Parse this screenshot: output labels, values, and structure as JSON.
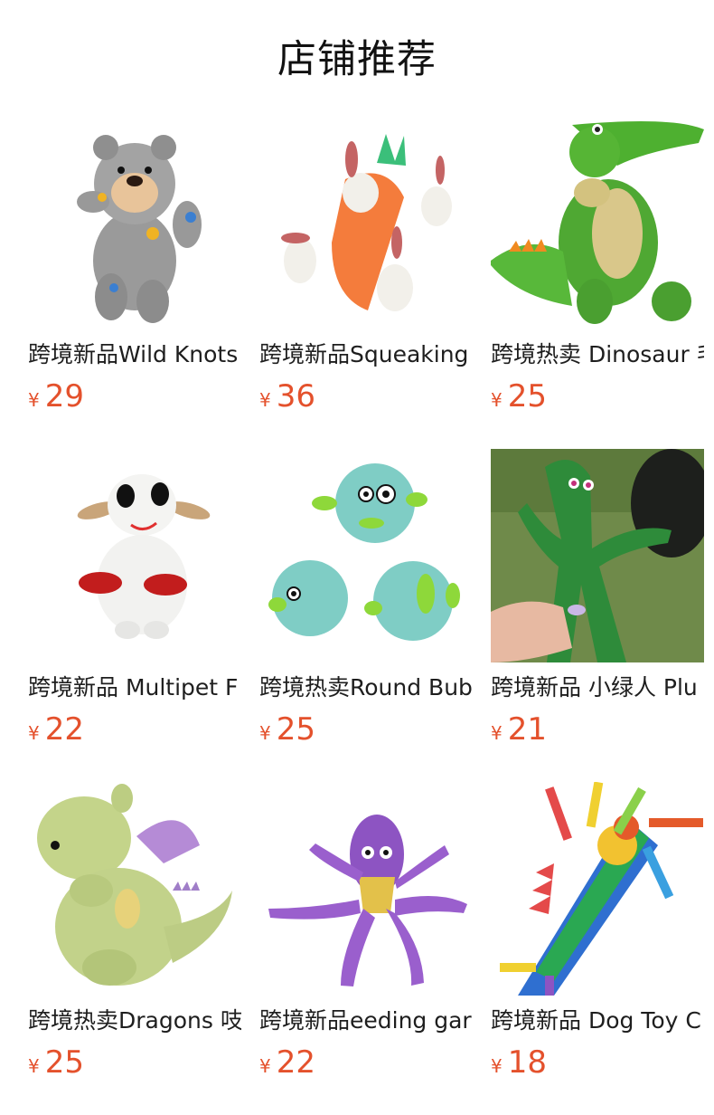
{
  "section_title": "店铺推荐",
  "currency_symbol": "¥",
  "price_color": "#e4512c",
  "products": [
    {
      "name": "跨境新品Wild Knots",
      "price": "29",
      "image": "grey-bear-plush"
    },
    {
      "name": "跨境新品Squeaking",
      "price": "36",
      "image": "carrot-bunnies-plush"
    },
    {
      "name": "跨境热卖 Dinosaur 毛",
      "price": "25",
      "image": "green-crocodile-plush"
    },
    {
      "name": "跨境新品 Multipet F",
      "price": "22",
      "image": "white-lamb-plush"
    },
    {
      "name": "跨境热卖Round Bub",
      "price": "25",
      "image": "teal-pufferfish-plush"
    },
    {
      "name": "跨境新品 小绿人 Plu",
      "price": "21",
      "image": "green-gumby-plush"
    },
    {
      "name": "跨境热卖Dragons 吱",
      "price": "25",
      "image": "green-dragon-plush"
    },
    {
      "name": "跨境新品eeding gar",
      "price": "22",
      "image": "purple-octopus-plush"
    },
    {
      "name": "跨境新品 Dog Toy C",
      "price": "18",
      "image": "colorful-ribbon-toy"
    }
  ]
}
